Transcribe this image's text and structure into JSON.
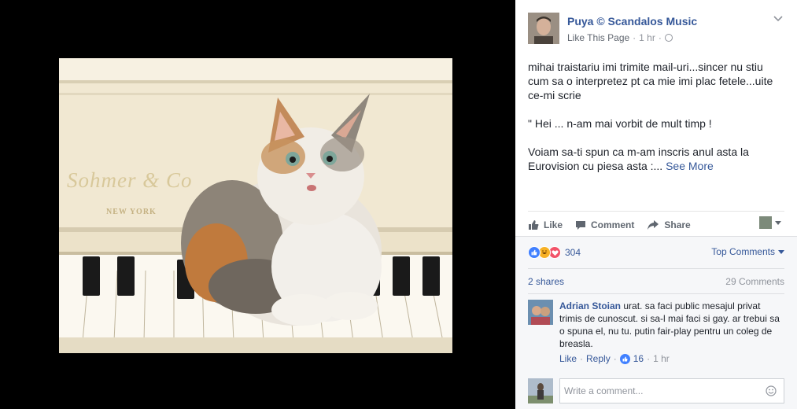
{
  "photo": {
    "brand_text": "Sohmer & Co",
    "city_text": "NEW YORK"
  },
  "post": {
    "page_name": "Puya © Scandalos Music",
    "like_page": "Like This Page",
    "separator": "·",
    "time": "1 hr",
    "text_p1": "mihai traistariu imi trimite mail-uri...sincer nu stiu cum sa o interpretez pt ca mie imi plac fetele...uite ce-mi scrie",
    "text_p2": "\" Hei ... n-am mai vorbit de mult timp !",
    "text_p3": "Voiam sa-ti spun ca m-am inscris anul asta la Eurovision cu piesa asta :...",
    "see_more": "See More"
  },
  "actions": {
    "like": "Like",
    "comment": "Comment",
    "share": "Share"
  },
  "reactions": {
    "count": "304",
    "top_comments": "Top Comments"
  },
  "stats": {
    "shares": "2 shares",
    "comments": "29 Comments"
  },
  "comment": {
    "author": "Adrian Stoian",
    "text": "urat. sa faci public mesajul privat trimis de cunoscut. si sa-l mai faci si gay. ar trebui sa o spuna el, nu tu. putin fair-play pentru un coleg de breasla.",
    "like": "Like",
    "reply": "Reply",
    "likes": "16",
    "time": "1 hr",
    "sep": "·"
  },
  "composer": {
    "placeholder": "Write a comment..."
  },
  "colors": {
    "link": "#365899",
    "like_blue": "#4080ff",
    "haha_yellow": "#f7b125",
    "love_red": "#f25268"
  }
}
